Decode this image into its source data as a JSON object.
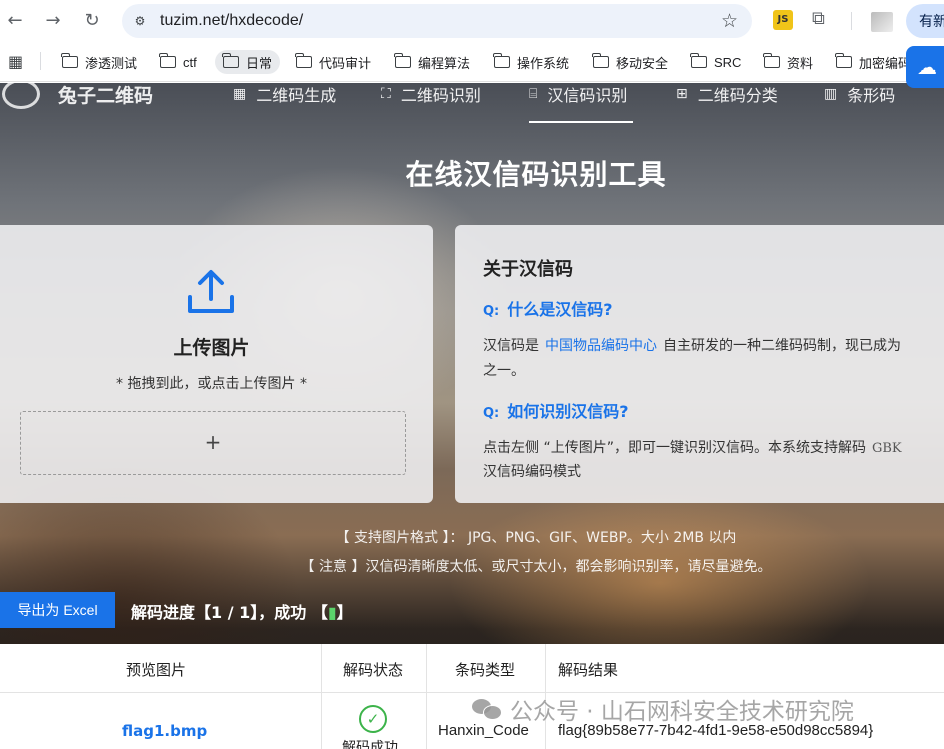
{
  "browser": {
    "url": "tuzim.net/hxdecode/",
    "update_label": "有新",
    "extension_badge": "JS",
    "bookmarks": [
      "渗透测试",
      "ctf",
      "日常",
      "代码审计",
      "编程算法",
      "操作系统",
      "移动安全",
      "SRC",
      "资料",
      "加密编码"
    ]
  },
  "site": {
    "logo": "兔子二维码",
    "nav": [
      {
        "label": "二维码生成",
        "icon": "qr-grid-icon"
      },
      {
        "label": "二维码识别",
        "icon": "scan-icon"
      },
      {
        "label": "汉信码识别",
        "icon": "terminal-icon",
        "active": true
      },
      {
        "label": "二维码分类",
        "icon": "category-icon"
      },
      {
        "label": "条形码",
        "icon": "barcode-icon"
      }
    ],
    "page_title": "在线汉信码识别工具"
  },
  "upload": {
    "title": "上传图片",
    "hint": "* 拖拽到此，或点击上传图片 *",
    "plus": "+"
  },
  "about": {
    "title": "关于汉信码",
    "q_mark": "Q:",
    "q1": "什么是汉信码?",
    "a1_pre": "汉信码是",
    "a1_link": "中国物品编码中心",
    "a1_post": "自主研发的一种二维码码制，现已成为",
    "a1_line2": "之一。",
    "q2": "如何识别汉信码?",
    "a2_pre": "点击左侧 “上传图片”，即可一键识别汉信码。本系统支持解码",
    "a2_mono": "GBK",
    "a2_line2": "汉信码编码模式"
  },
  "notices": {
    "formats": "【 支持图片格式 】： JPG、PNG、GIF、WEBP。大小 2MB 以内",
    "warning": "【 注意 】汉信码清晰度太低、或尺寸太小，都会影响识别率，请尽量避免。"
  },
  "results": {
    "export_label": "导出为 Excel",
    "progress": "解码进度【1 / 1】，成功 【",
    "progress_end": "】",
    "columns": [
      "预览图片",
      "解码状态",
      "条码类型",
      "解码结果"
    ],
    "rows": [
      {
        "file": "flag1.bmp",
        "status": "解码成功",
        "type": "Hanxin_Code",
        "result": "flag{89b58e77-7b42-4fd1-9e58-e50d98cc5894}"
      }
    ]
  },
  "watermark": "公众号 · 山石网科安全技术研究院"
}
